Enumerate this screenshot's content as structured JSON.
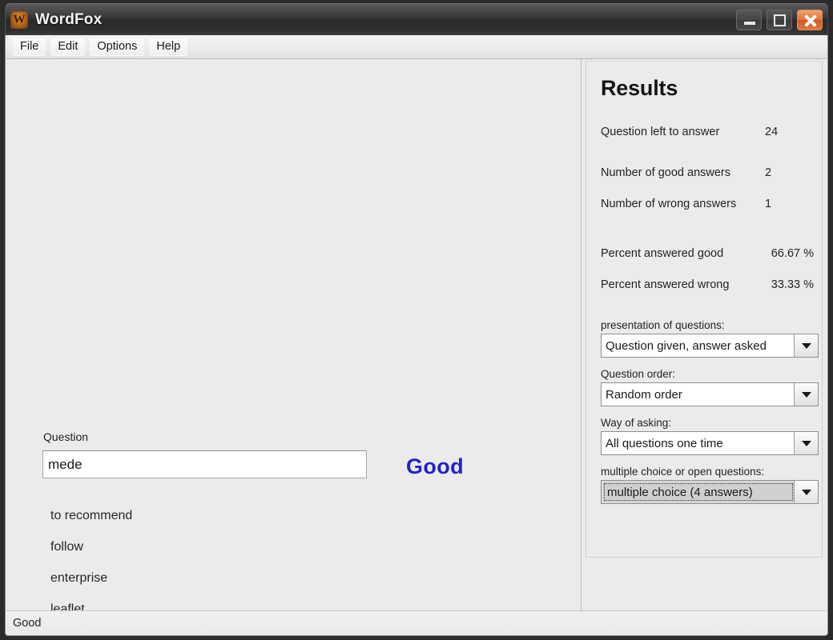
{
  "window": {
    "title": "WordFox",
    "icon": "wordfox-logo-icon",
    "controls": {
      "minimize": "minimize-icon",
      "maximize": "maximize-icon",
      "close": "close-icon"
    }
  },
  "menubar": {
    "items": [
      {
        "label": "File"
      },
      {
        "label": "Edit"
      },
      {
        "label": "Options"
      },
      {
        "label": "Help"
      }
    ]
  },
  "quiz": {
    "question_label": "Question",
    "question_value": "mede",
    "question_placeholder": "",
    "verdict": "Good",
    "verdict_color": "#2222cc",
    "answers": [
      {
        "label": "to recommend"
      },
      {
        "label": "follow"
      },
      {
        "label": "enterprise"
      },
      {
        "label": "leaflet"
      }
    ]
  },
  "results": {
    "title": "Results",
    "stats": [
      {
        "label": "Question left to answer",
        "value": "24"
      },
      {
        "label": "Number of good answers",
        "value": "2"
      },
      {
        "label": "Number of wrong answers",
        "value": "1"
      },
      {
        "label": "Percent answered good",
        "value": "66.67 %"
      },
      {
        "label": "Percent  answered wrong",
        "value": "33.33 %"
      }
    ],
    "settings": [
      {
        "label": "presentation of questions:",
        "selected": "Question given, answer asked",
        "arrow": "chevron-down-icon",
        "focused": false
      },
      {
        "label": "Question order:",
        "selected": "Random order",
        "arrow": "chevron-down-icon",
        "focused": false
      },
      {
        "label": "Way of asking:",
        "selected": "All questions one time",
        "arrow": "chevron-down-icon",
        "focused": false
      },
      {
        "label": "multiple choice or open questions:",
        "selected": "multiple choice (4 answers)",
        "arrow": "chevron-down-icon",
        "focused": true
      }
    ]
  },
  "statusbar": {
    "text": "Good"
  }
}
